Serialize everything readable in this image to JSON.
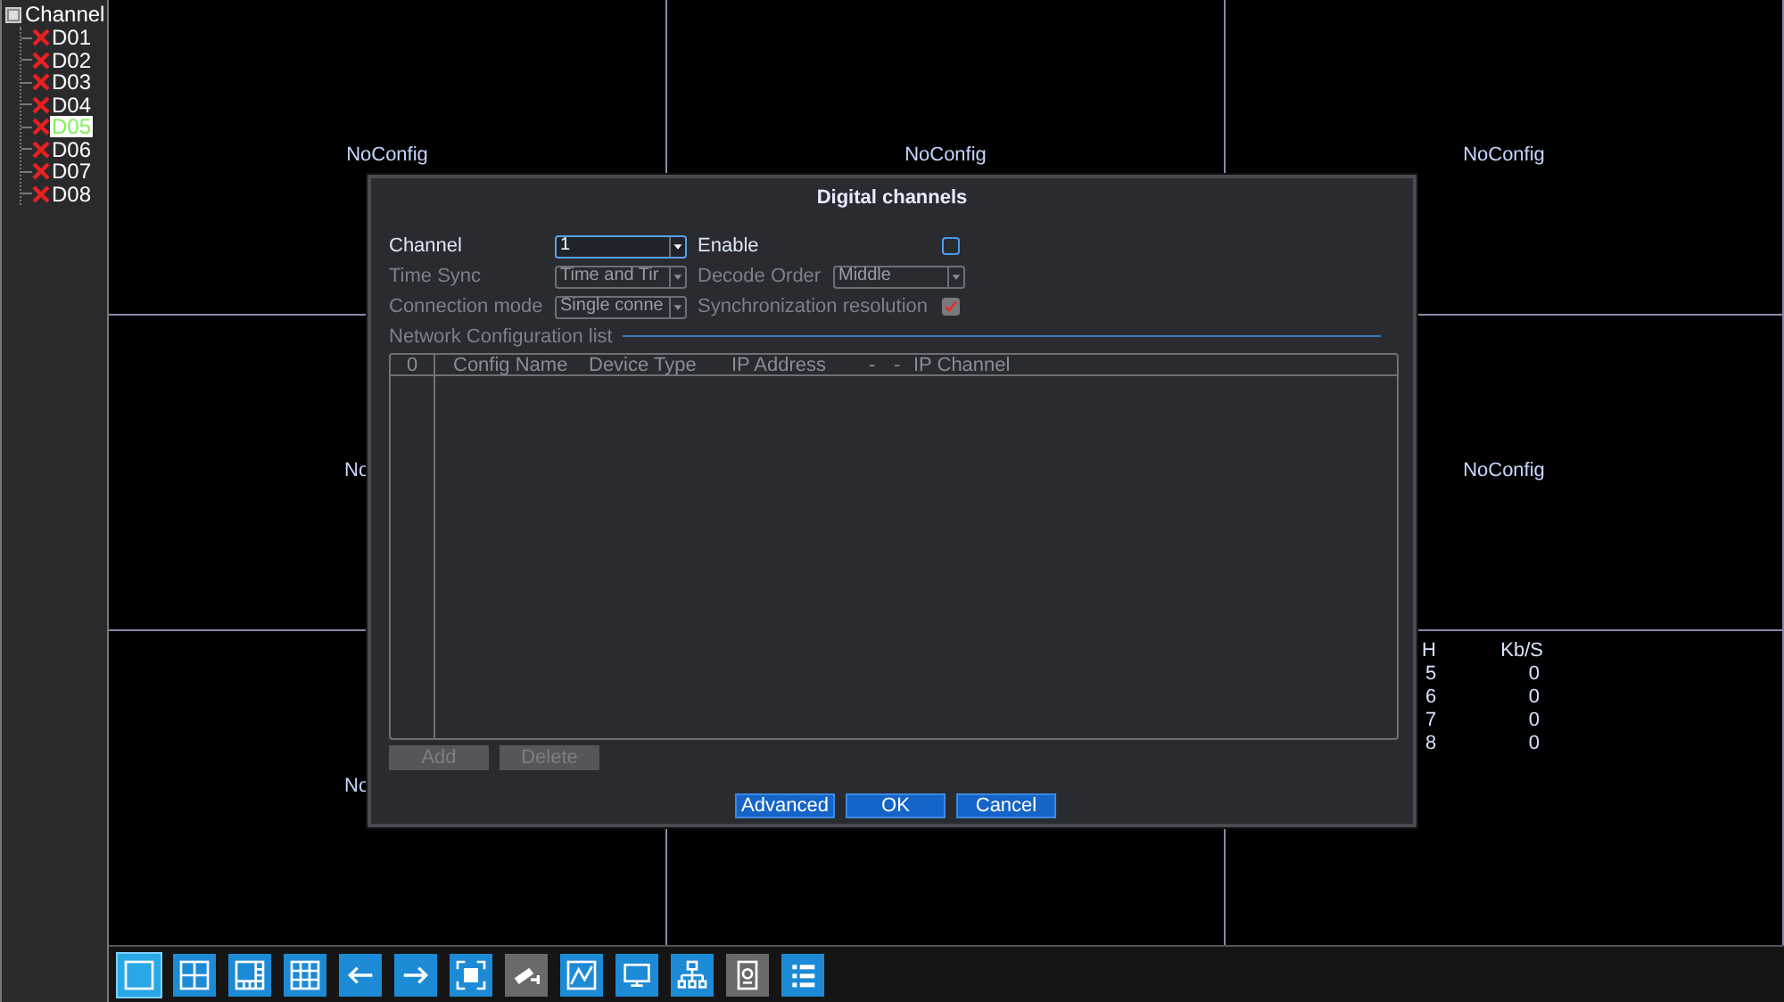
{
  "sidebar": {
    "title": "Channel",
    "items": [
      {
        "label": "D01",
        "selected": false
      },
      {
        "label": "D02",
        "selected": false
      },
      {
        "label": "D03",
        "selected": false
      },
      {
        "label": "D04",
        "selected": false
      },
      {
        "label": "D05",
        "selected": true
      },
      {
        "label": "D06",
        "selected": false
      },
      {
        "label": "D07",
        "selected": false
      },
      {
        "label": "D08",
        "selected": false
      }
    ]
  },
  "grid": {
    "cells": [
      {
        "label": "NoConfig",
        "cut": false
      },
      {
        "label": "NoConfig",
        "cut": false
      },
      {
        "label": "NoConfig",
        "cut": false
      },
      {
        "label": "No",
        "cut": true
      },
      {},
      {
        "label": "NoConfig",
        "cut": false
      },
      {
        "label": "No",
        "cut": true
      },
      {},
      {
        "stats": {
          "headers": [
            "H",
            "Kb/S"
          ],
          "rows": [
            [
              "5",
              "0"
            ],
            [
              "6",
              "0"
            ],
            [
              "7",
              "0"
            ],
            [
              "8",
              "0"
            ]
          ]
        }
      }
    ]
  },
  "dialog": {
    "title": "Digital channels",
    "fields": [
      {
        "label": "Channel",
        "kind": "select",
        "value": "1",
        "disabled": false
      },
      {
        "label": "Enable",
        "kind": "checkbox",
        "checked": false,
        "disabled": false
      },
      {
        "label": "Time Sync",
        "kind": "select",
        "value": "Time and Tir",
        "disabled": true
      },
      {
        "label": "Decode Order",
        "kind": "select",
        "value": "Middle",
        "disabled": true
      },
      {
        "label": "Connection mode",
        "kind": "select",
        "value": "Single conne",
        "disabled": true
      },
      {
        "label": "Synchronization resolution",
        "kind": "checkbox",
        "checked": true,
        "disabled": true
      }
    ],
    "section": "Network Configuration list",
    "table": {
      "columns": [
        "0",
        "Config Name",
        "Device Type",
        "IP Address",
        "-",
        "-",
        "IP Channel"
      ]
    },
    "list_buttons": [
      {
        "label": "Add",
        "disabled": true
      },
      {
        "label": "Delete",
        "disabled": true
      }
    ],
    "buttons": [
      "Advanced",
      "OK",
      "Cancel"
    ]
  },
  "toolbar": [
    {
      "selected": true,
      "disabled": false
    },
    {
      "selected": false,
      "disabled": false
    },
    {
      "selected": false,
      "disabled": false
    },
    {
      "selected": false,
      "disabled": false
    },
    {
      "selected": false,
      "disabled": false
    },
    {
      "selected": false,
      "disabled": false
    },
    {
      "selected": false,
      "disabled": false
    },
    {
      "selected": false,
      "disabled": true
    },
    {
      "selected": false,
      "disabled": false
    },
    {
      "selected": false,
      "disabled": false
    },
    {
      "selected": false,
      "disabled": false
    },
    {
      "selected": false,
      "disabled": true
    },
    {
      "selected": false,
      "disabled": false
    }
  ]
}
